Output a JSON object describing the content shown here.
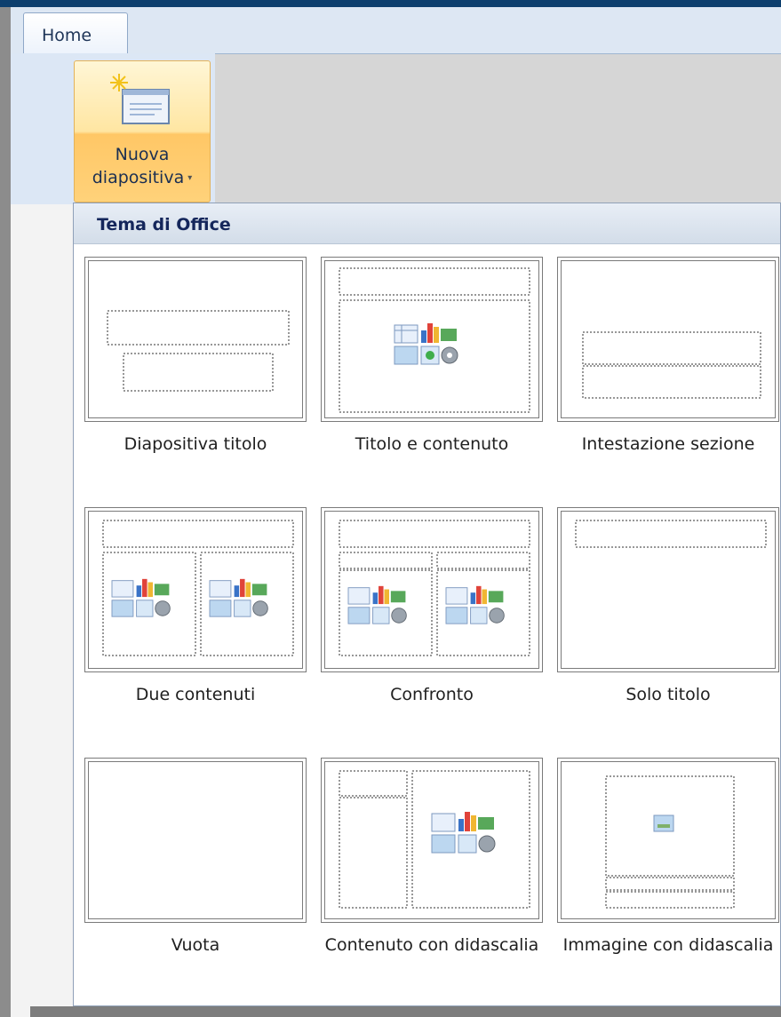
{
  "ribbon": {
    "tab_home": "Home",
    "new_slide": {
      "line1": "Nuova",
      "line2": "diapositiva",
      "arrow": "▾"
    }
  },
  "gallery": {
    "title": "Tema di Office",
    "layouts": [
      {
        "label": "Diapositiva titolo",
        "icon": "title-slide-layout-icon"
      },
      {
        "label": "Titolo e contenuto",
        "icon": "title-content-layout-icon"
      },
      {
        "label": "Intestazione sezione",
        "icon": "section-header-layout-icon"
      },
      {
        "label": "Due contenuti",
        "icon": "two-content-layout-icon"
      },
      {
        "label": "Confronto",
        "icon": "comparison-layout-icon"
      },
      {
        "label": "Solo titolo",
        "icon": "title-only-layout-icon"
      },
      {
        "label": "Vuota",
        "icon": "blank-layout-icon"
      },
      {
        "label": "Contenuto con didascalia",
        "icon": "content-caption-layout-icon"
      },
      {
        "label": "Immagine con didascalia",
        "icon": "picture-caption-layout-icon"
      }
    ]
  },
  "colors": {
    "accent_button": "#ffc766",
    "panel_title": "#14265b",
    "window_frame": "#0d3f6e"
  }
}
